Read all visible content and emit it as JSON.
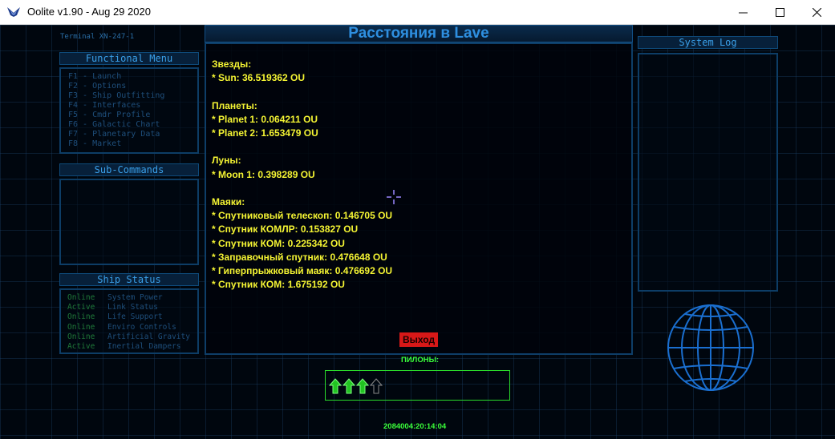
{
  "window": {
    "title": "Oolite v1.90 - Aug 29 2020"
  },
  "terminal_id": "Terminal XN-247-1",
  "functional_menu": {
    "title": "Functional Menu",
    "items": [
      "F1 - Launch",
      "F2 - Options",
      "F3 - Ship Outfitting",
      "F4 - Interfaces",
      "F5 - Cmdr Profile",
      "F6 - Galactic Chart",
      "F7 - Planetary Data",
      "F8 - Market"
    ]
  },
  "sub_commands": {
    "title": "Sub-Commands"
  },
  "ship_status": {
    "title": "Ship Status",
    "rows": [
      {
        "state": "Online",
        "name": "System Power"
      },
      {
        "state": "Active",
        "name": "Link Status"
      },
      {
        "state": "Online",
        "name": "Life Support"
      },
      {
        "state": "Online",
        "name": "Enviro Controls"
      },
      {
        "state": "Online",
        "name": "Artificial Gravity"
      },
      {
        "state": "Active",
        "name": "Inertial Dampers"
      }
    ]
  },
  "main": {
    "title": "Расстояния в Lave",
    "lines": [
      "Звезды:",
      "* Sun: 36.519362 OU",
      "",
      "Планеты:",
      "* Planet 1: 0.064211 OU",
      "* Planet 2: 1.653479 OU",
      "",
      "Луны:",
      "* Moon 1: 0.398289 OU",
      "",
      "Маяки:",
      "* Спутниковый телескоп: 0.146705 OU",
      "* Спутник КОМЛР: 0.153827 OU",
      "* Спутник КОМ: 0.225342 OU",
      "* Заправочный спутник: 0.476648 OU",
      "* Гиперпрыжковый маяк: 0.476692 OU",
      "* Спутник КОМ: 1.675192 OU"
    ],
    "exit_label": "Выход"
  },
  "pylons": {
    "label": "ПИЛОНЫ:",
    "loaded": 3,
    "total": 4
  },
  "system_log": {
    "title": "System Log"
  },
  "clock": "2084004:20:14:04",
  "colors": {
    "text_yellow": "#f5f533",
    "accent_blue": "#2e8fe0",
    "hud_green": "#3aff3a",
    "exit_red": "#d81818"
  }
}
